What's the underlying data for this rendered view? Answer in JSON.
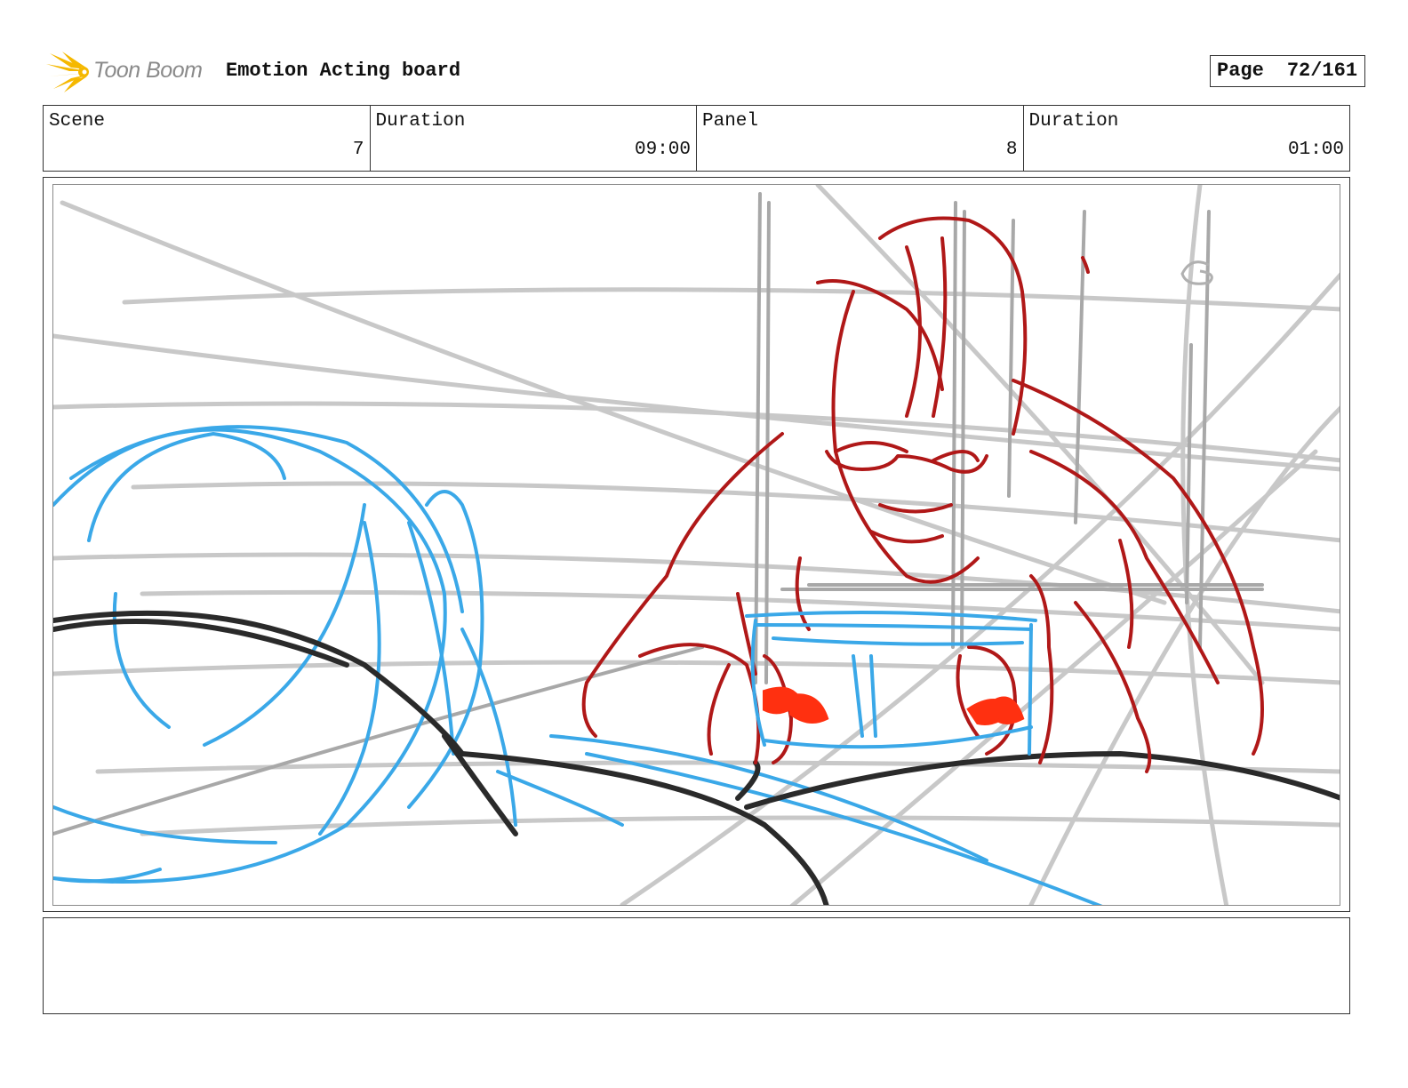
{
  "header": {
    "logo_text": "Toon Boom",
    "board_title": "Emotion Acting board",
    "page_label": "Page",
    "page_value": "72/161"
  },
  "info": {
    "scene_label": "Scene",
    "scene_value": "7",
    "scene_duration_label": "Duration",
    "scene_duration_value": "09:00",
    "panel_label": "Panel",
    "panel_value": "8",
    "panel_duration_label": "Duration",
    "panel_duration_value": "01:00"
  },
  "colors": {
    "logo_yellow": "#f5b800",
    "sketch_gray": "#c8c8c8",
    "sketch_blue": "#3aa8e8",
    "sketch_red": "#b01818",
    "sketch_orange": "#ff3010",
    "sketch_dark": "#2a2a2a"
  },
  "notes": {
    "text": ""
  }
}
